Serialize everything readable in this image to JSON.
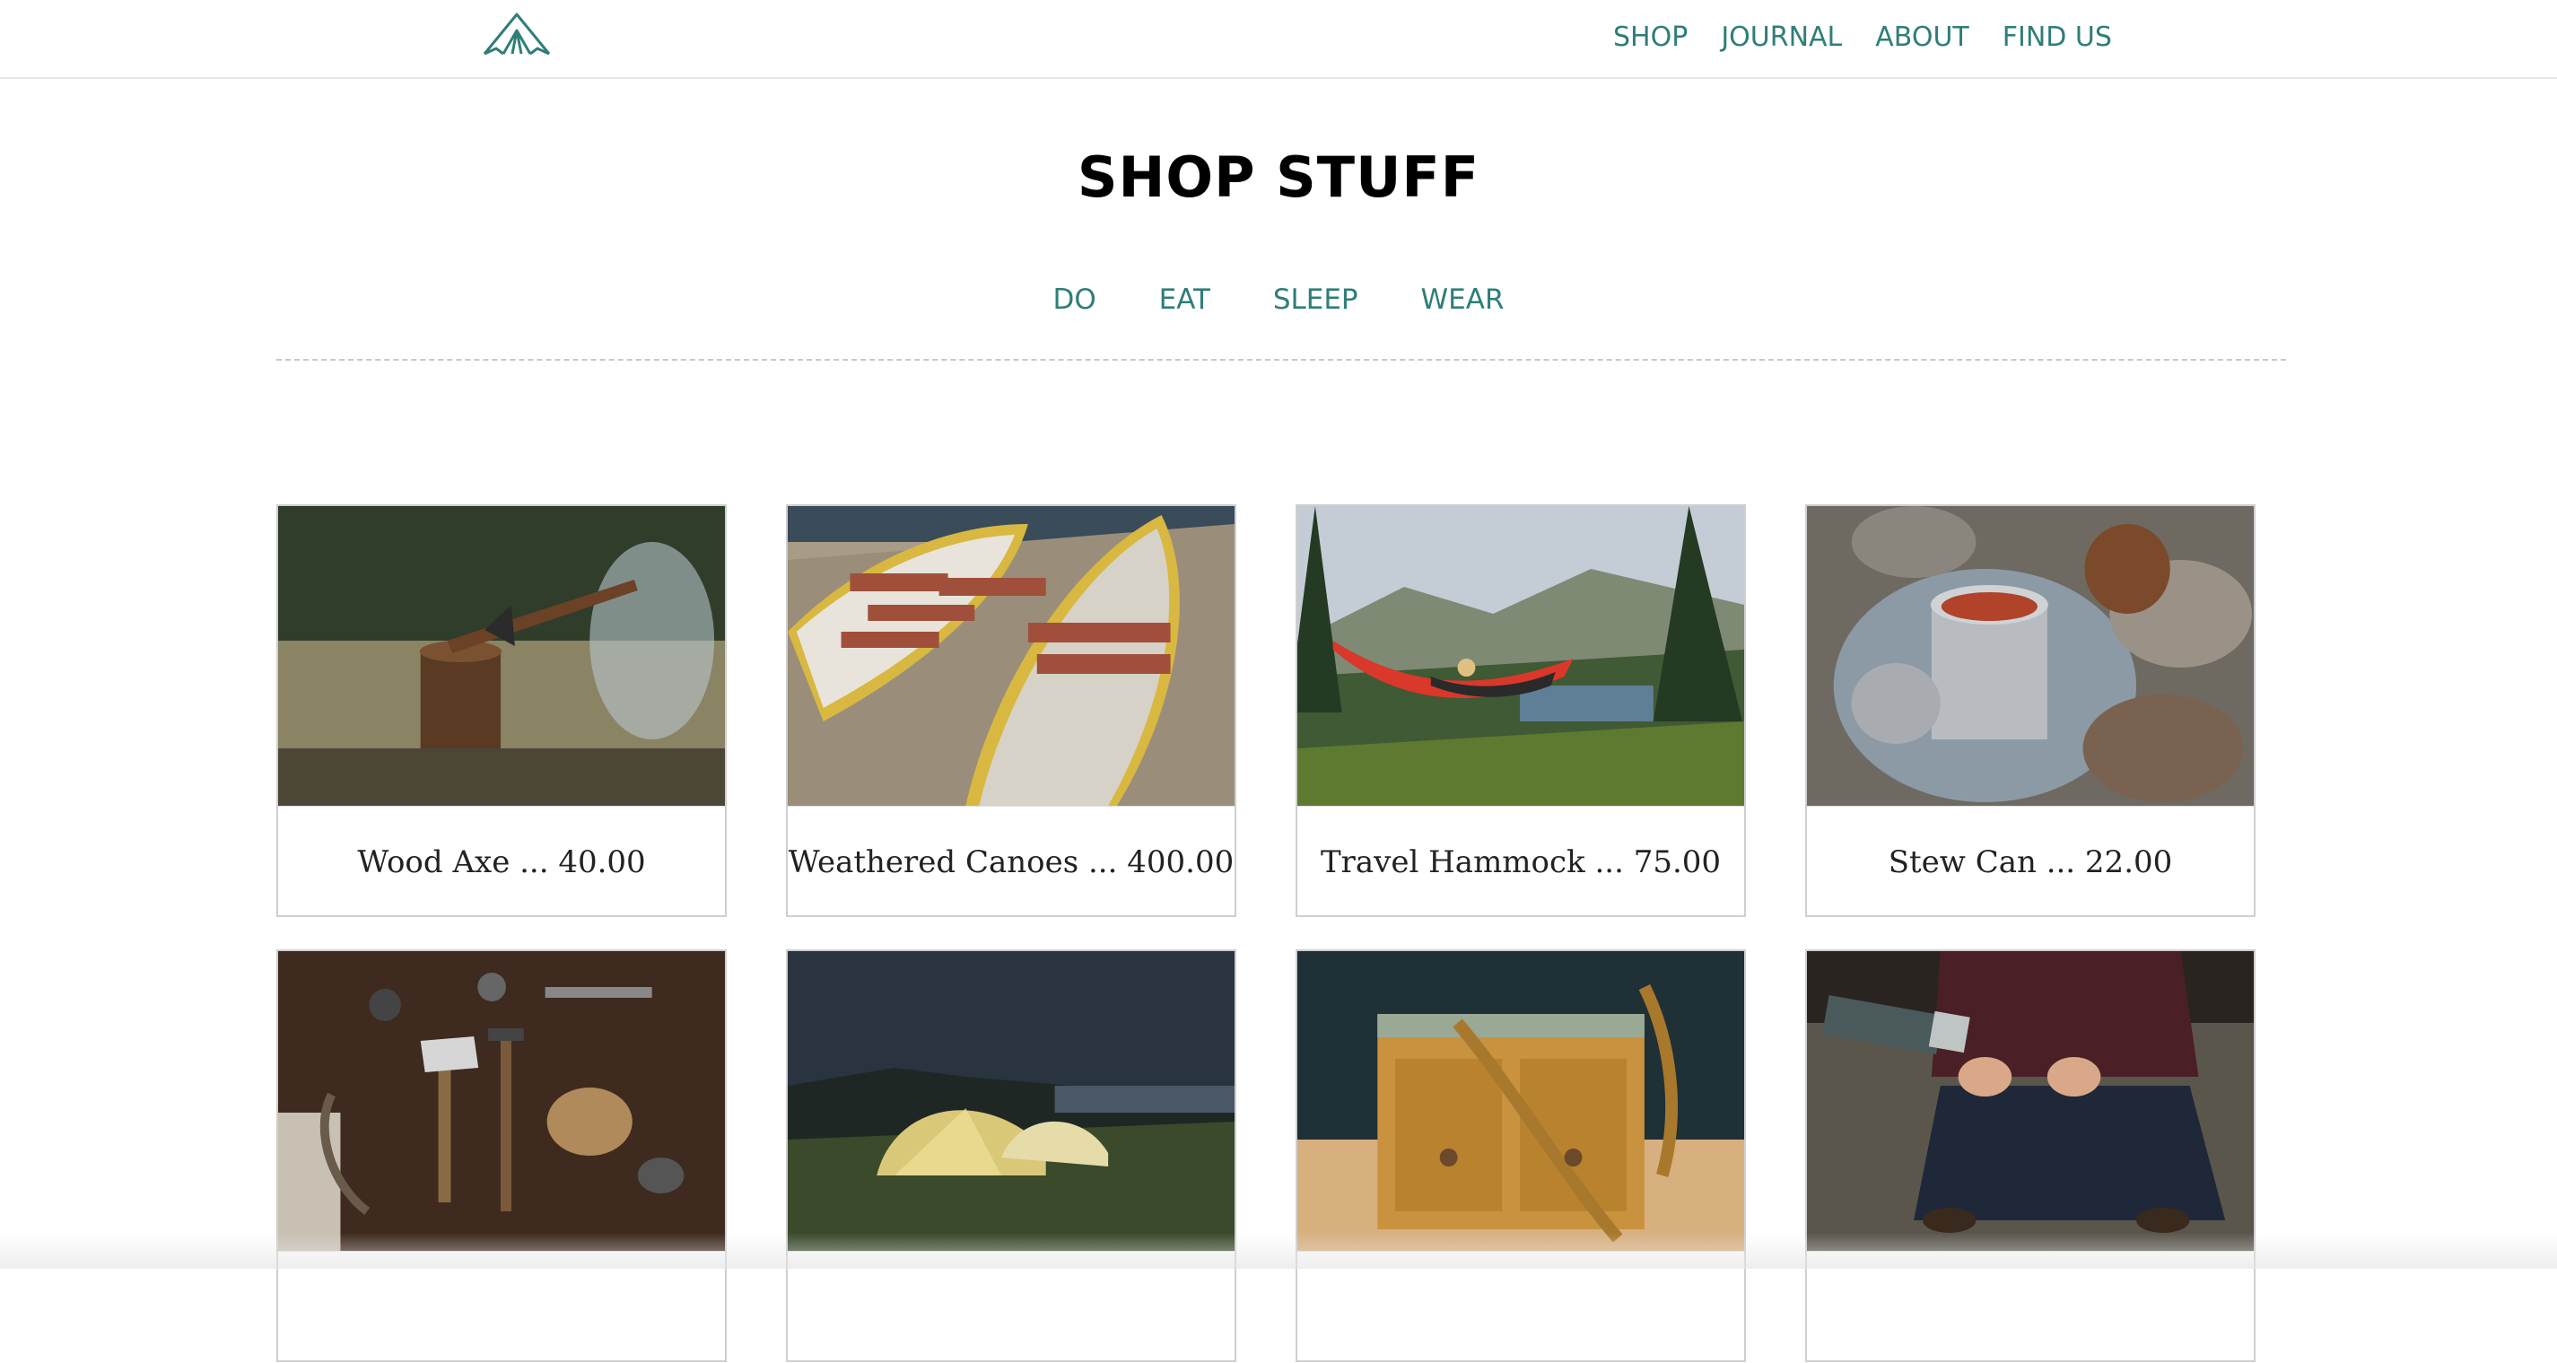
{
  "header": {
    "logo": "tent-logo",
    "nav": [
      "SHOP",
      "JOURNAL",
      "ABOUT",
      "FIND US"
    ]
  },
  "main": {
    "title": "SHOP STUFF",
    "categories": [
      "DO",
      "EAT",
      "SLEEP",
      "WEAR"
    ],
    "products": [
      {
        "caption": "Wood Axe ... 40.00",
        "image": "axe-in-stump-photo"
      },
      {
        "caption": "Weathered Canoes ... 400.00",
        "image": "canoes-on-dock-photo"
      },
      {
        "caption": "Travel Hammock ... 75.00",
        "image": "hammock-mountains-photo"
      },
      {
        "caption": "Stew Can ... 22.00",
        "image": "stew-pot-on-rocks-photo"
      },
      {
        "caption": "",
        "image": "tools-flatlay-photo"
      },
      {
        "caption": "",
        "image": "tents-at-night-photo"
      },
      {
        "caption": "",
        "image": "canvas-bag-photo"
      },
      {
        "caption": "",
        "image": "thermos-pour-photo"
      }
    ]
  },
  "colors": {
    "accent": "#2f7e78",
    "border": "#cfcfcf",
    "text": "#222222"
  }
}
